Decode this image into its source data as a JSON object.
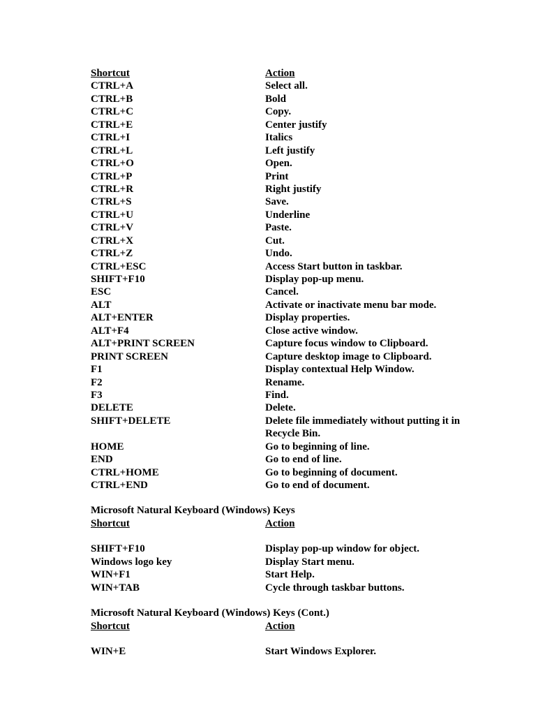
{
  "header": {
    "shortcut": "Shortcut",
    "action": "Action"
  },
  "sections": [
    {
      "title": null,
      "rows": [
        {
          "s": "CTRL+A",
          "a": "Select all."
        },
        {
          "s": "CTRL+B",
          "a": "Bold"
        },
        {
          "s": "CTRL+C",
          "a": "Copy."
        },
        {
          "s": "CTRL+E",
          "a": "Center justify"
        },
        {
          "s": "CTRL+I",
          "a": "Italics"
        },
        {
          "s": "CTRL+L",
          "a": "Left justify"
        },
        {
          "s": "CTRL+O",
          "a": "Open."
        },
        {
          "s": "CTRL+P",
          "a": "Print"
        },
        {
          "s": "CTRL+R",
          "a": "Right justify"
        },
        {
          "s": "CTRL+S",
          "a": "Save."
        },
        {
          "s": "CTRL+U",
          "a": "Underline"
        },
        {
          "s": "CTRL+V",
          "a": "Paste."
        },
        {
          "s": "CTRL+X",
          "a": "Cut."
        },
        {
          "s": "CTRL+Z",
          "a": "Undo."
        },
        {
          "s": "CTRL+ESC",
          "a": "Access Start button in taskbar."
        },
        {
          "s": "SHIFT+F10",
          "a": "Display pop-up menu."
        },
        {
          "s": "ESC",
          "a": "Cancel."
        },
        {
          "s": "ALT",
          "a": "Activate or inactivate menu bar mode."
        },
        {
          "s": "ALT+ENTER",
          "a": "Display properties."
        },
        {
          "s": "ALT+F4",
          "a": "Close active window."
        },
        {
          "s": "ALT+PRINT SCREEN",
          "a": "Capture focus window to Clipboard."
        },
        {
          "s": "PRINT SCREEN",
          "a": "Capture desktop image to Clipboard."
        },
        {
          "s": "F1",
          "a": "Display contextual Help Window."
        },
        {
          "s": "F2",
          "a": "Rename."
        },
        {
          "s": "F3",
          "a": "Find."
        },
        {
          "s": "DELETE",
          "a": "Delete."
        },
        {
          "s": "SHIFT+DELETE",
          "a": "Delete file immediately without putting it in Recycle Bin."
        },
        {
          "s": "HOME",
          "a": "Go to beginning of line."
        },
        {
          "s": "END",
          "a": "Go to end of line."
        },
        {
          "s": "CTRL+HOME",
          "a": "Go to beginning of document."
        },
        {
          "s": "CTRL+END",
          "a": "Go to end of document."
        }
      ]
    },
    {
      "title": "Microsoft Natural Keyboard (Windows) Keys",
      "rows": [
        {
          "s": "SHIFT+F10",
          "a": "Display pop-up window for object."
        },
        {
          "s": "Windows logo key",
          "a": "Display Start menu."
        },
        {
          "s": "WIN+F1",
          "a": "Start Help."
        },
        {
          "s": "WIN+TAB",
          "a": "Cycle through taskbar buttons."
        }
      ]
    },
    {
      "title": "Microsoft Natural Keyboard (Windows) Keys (Cont.)",
      "rows": [
        {
          "s": "WIN+E",
          "a": "Start Windows Explorer."
        }
      ]
    }
  ]
}
